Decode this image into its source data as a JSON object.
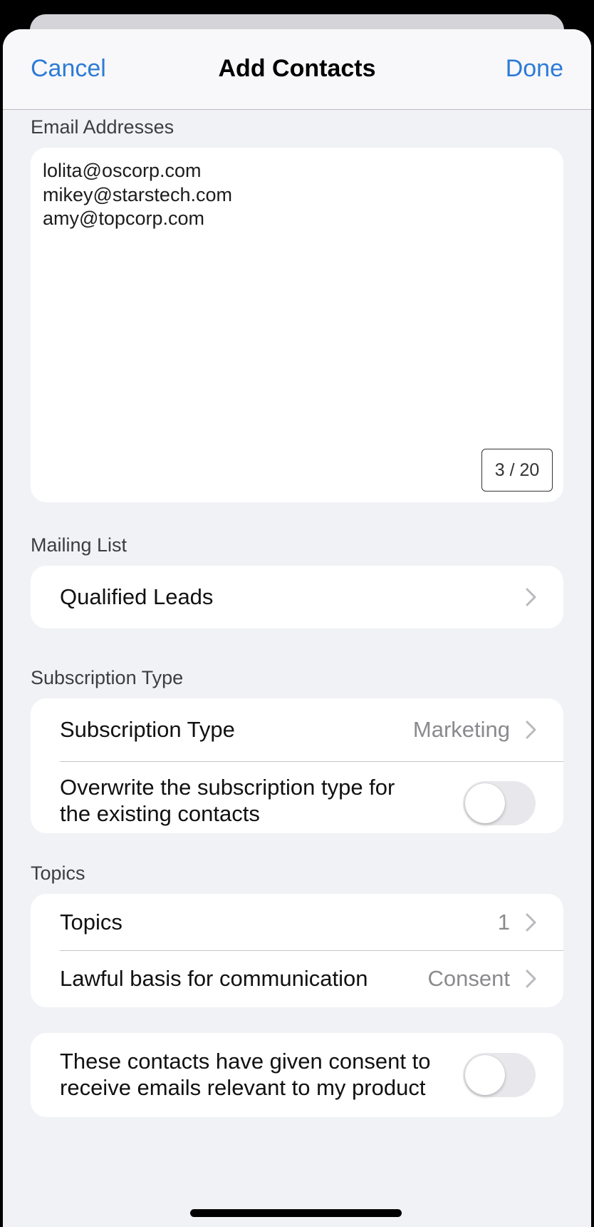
{
  "nav": {
    "cancel_label": "Cancel",
    "title": "Add Contacts",
    "done_label": "Done"
  },
  "email_section": {
    "label": "Email Addresses",
    "emails": [
      "lolita@oscorp.com",
      "mikey@starstech.com",
      "amy@topcorp.com"
    ],
    "counter": "3 / 20"
  },
  "mailing_section": {
    "label": "Mailing List",
    "selected_list": "Qualified Leads"
  },
  "subscription_section": {
    "label": "Subscription Type",
    "row_label": "Subscription Type",
    "row_value": "Marketing",
    "overwrite_label_line1": "Overwrite the subscription type for",
    "overwrite_label_line2": "the existing contacts",
    "overwrite_enabled": false
  },
  "topics_section": {
    "label": "Topics",
    "topics_label": "Topics",
    "topics_value": "1",
    "lawful_label": "Lawful basis for communication",
    "lawful_value": "Consent"
  },
  "consent_section": {
    "label_line1": "These contacts have given consent to",
    "label_line2": "receive emails relevant to my product",
    "consent_enabled": false
  },
  "colors": {
    "accent": "#2d7bd6",
    "background": "#f1f2f5",
    "card": "#ffffff",
    "secondary_text": "#8a8a8e"
  },
  "icons": {
    "disclosure": "chevron-right-icon"
  }
}
